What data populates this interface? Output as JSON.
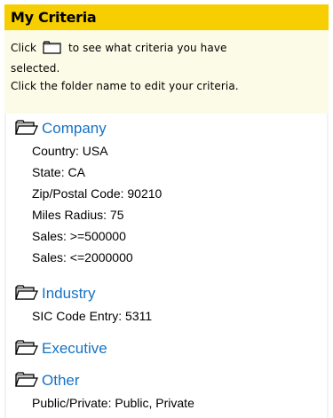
{
  "panel": {
    "title": "My Criteria",
    "instructions": {
      "part1": "Click",
      "part2": "to see what criteria you have",
      "line2": "selected.",
      "line3": "Click the folder name to edit your criteria."
    }
  },
  "groups": [
    {
      "name": "Company",
      "icon": "folder-icon",
      "items": [
        "Country: USA",
        "State: CA",
        "Zip/Postal Code: 90210",
        "Miles Radius: 75",
        "Sales: >=500000",
        "Sales: <=2000000"
      ]
    },
    {
      "name": "Industry",
      "icon": "folder-icon",
      "items": [
        "SIC Code Entry: 5311"
      ]
    },
    {
      "name": "Executive",
      "icon": "folder-icon",
      "items": []
    },
    {
      "name": "Other",
      "icon": "folder-icon",
      "items": [
        "Public/Private: Public, Private"
      ]
    }
  ],
  "colors": {
    "header_bg": "#f7cf00",
    "instructions_bg": "#fbfbe7",
    "link": "#1772c4"
  }
}
